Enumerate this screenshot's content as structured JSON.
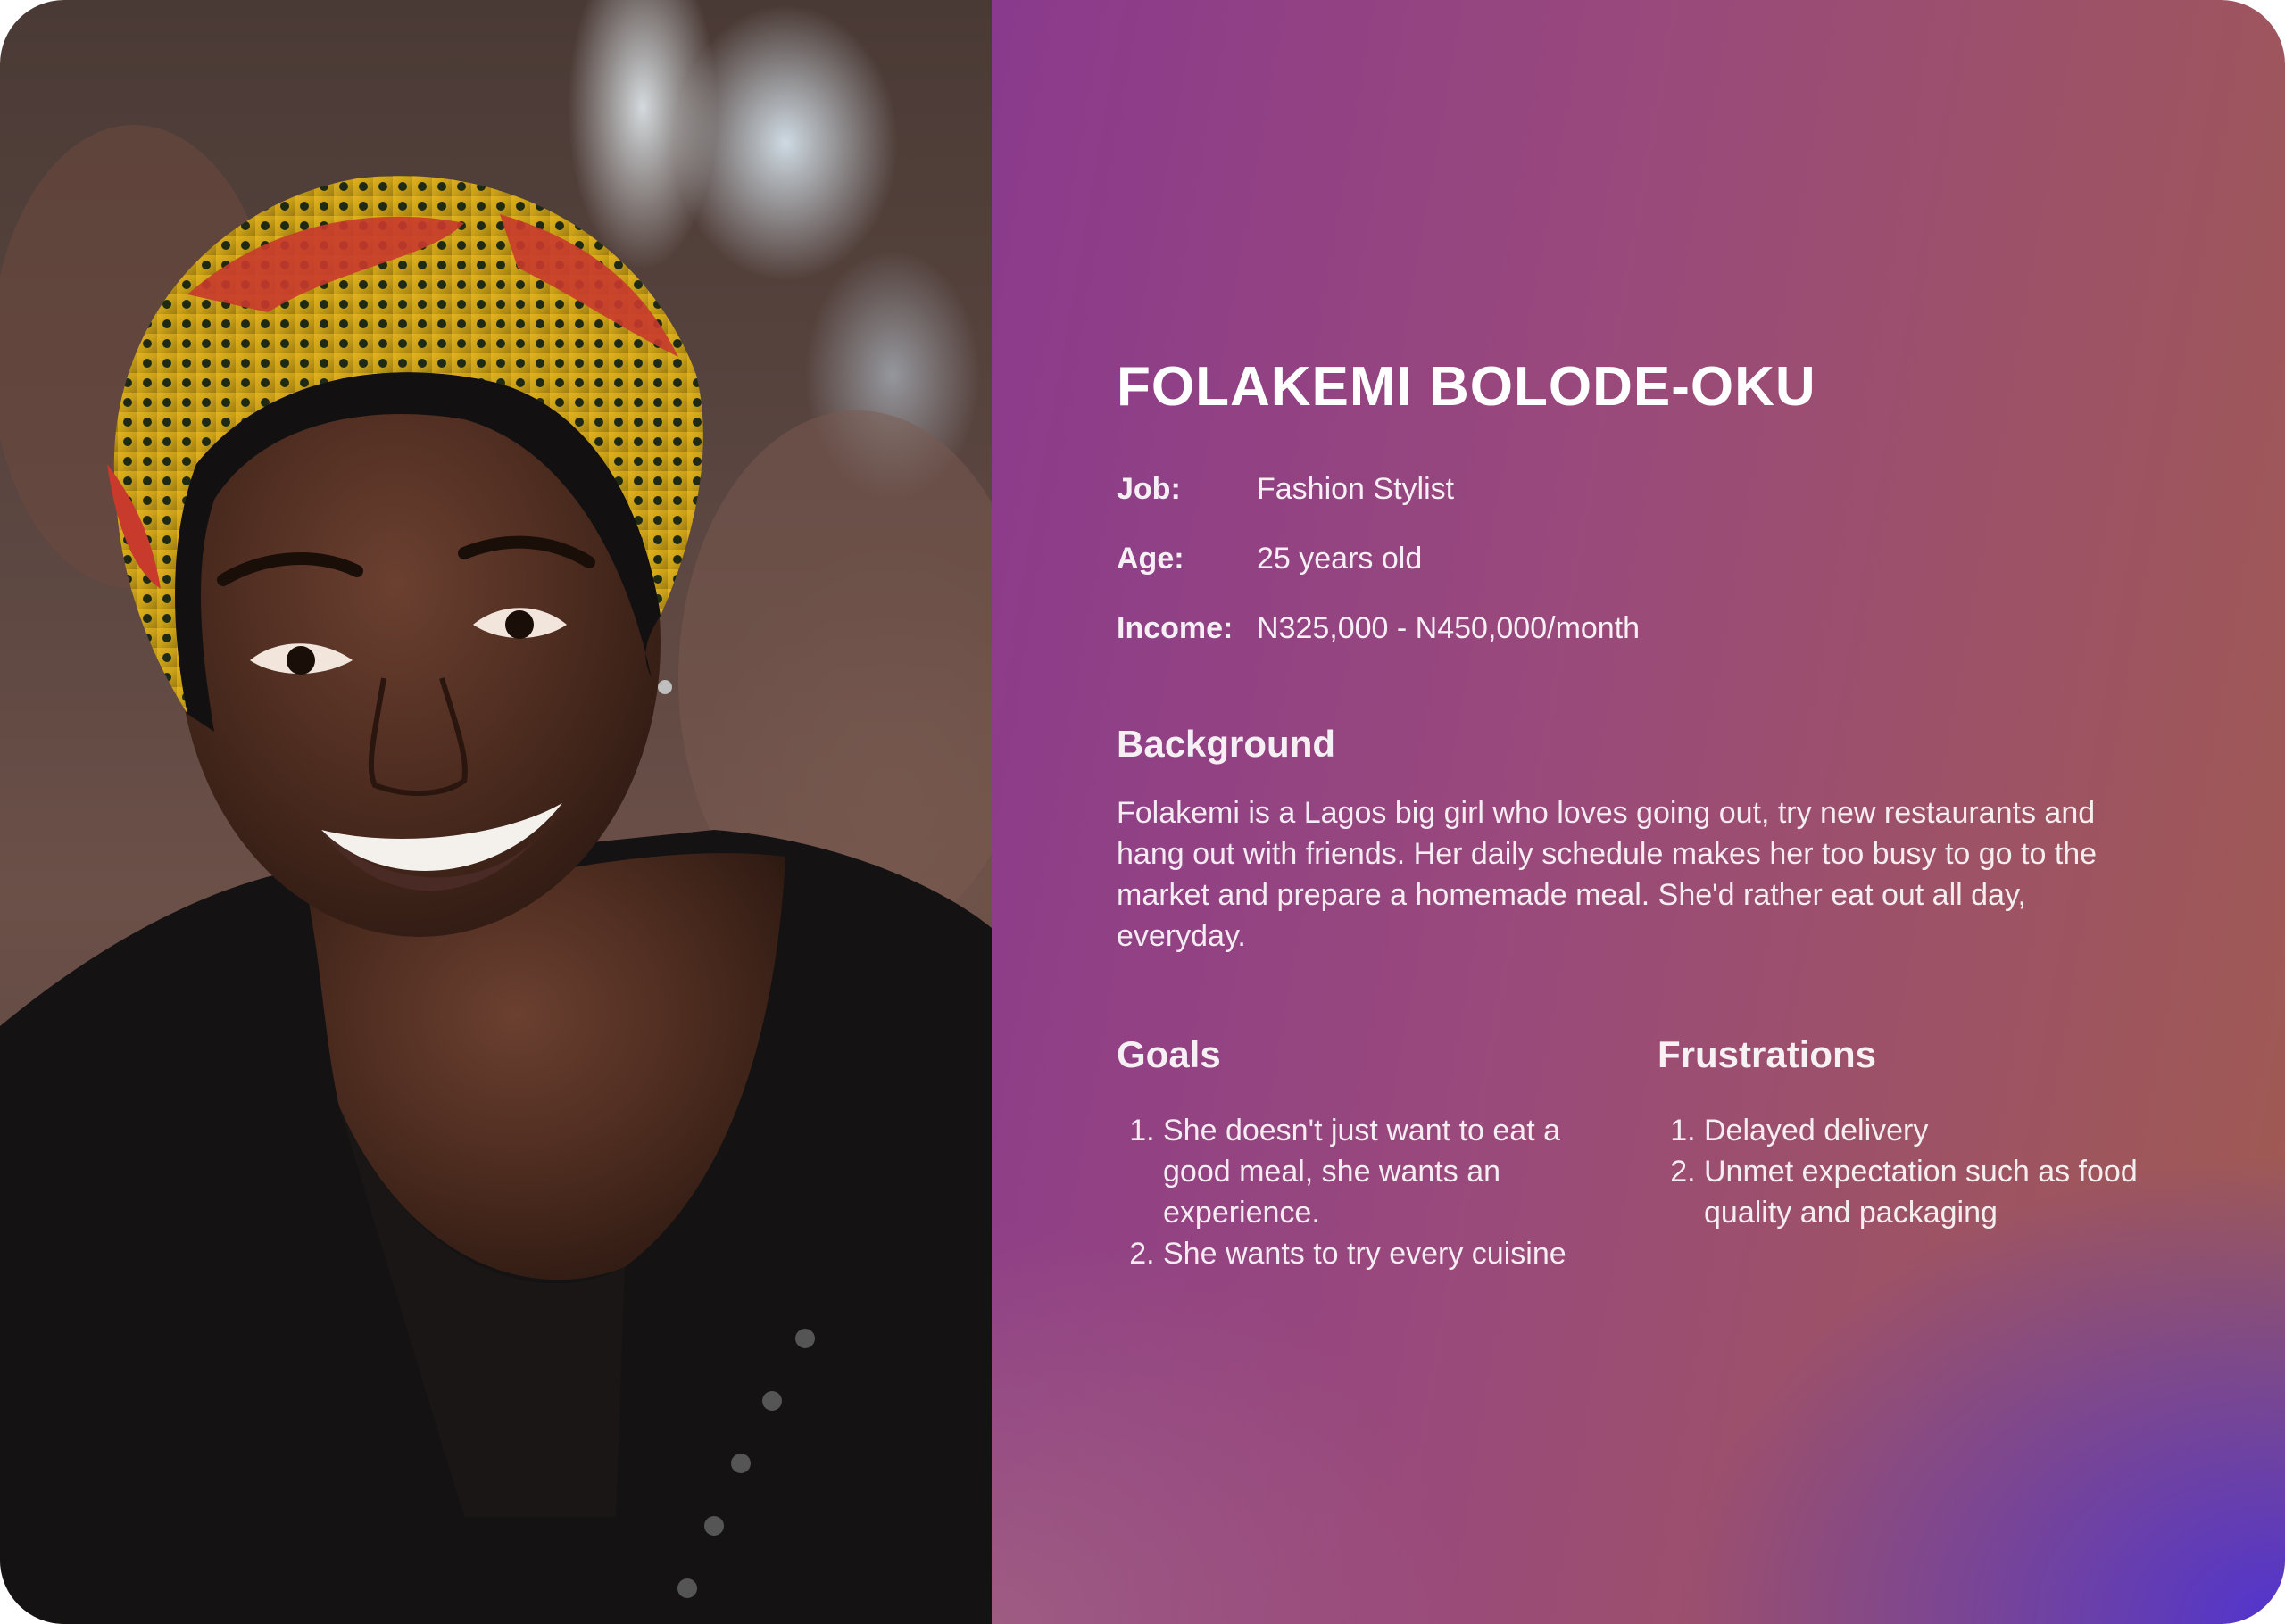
{
  "persona": {
    "name": "FOLAKEMI BOLODE-OKU",
    "details": [
      {
        "label": "Job:",
        "value": "Fashion Stylist"
      },
      {
        "label": "Age:",
        "value": "25 years old"
      },
      {
        "label": "Income:",
        "value": "N325,000 - N450,000/month"
      }
    ],
    "background": {
      "heading": "Background",
      "text": "Folakemi is a Lagos big girl who loves going out, try new restaurants and hang out with friends. Her daily schedule makes her too busy to go to the market and prepare a homemade meal. She'd rather eat out all day, everyday."
    },
    "goals": {
      "heading": "Goals",
      "items": [
        "She doesn't just want to eat a good meal, she wants an experience.",
        "She wants to try every cuisine"
      ]
    },
    "frustrations": {
      "heading": "Frustrations",
      "items": [
        "Delayed delivery",
        "Unmet expectation such as food quality and packaging"
      ]
    }
  },
  "photo": {
    "subject": "smiling woman wearing a yellow and red patterned head wrap and black top"
  },
  "colors": {
    "gradient_start": "#8a3a8c",
    "gradient_end_top": "#a05b50",
    "gradient_end_bottom": "#4c32d7",
    "text": "#ffffff"
  }
}
